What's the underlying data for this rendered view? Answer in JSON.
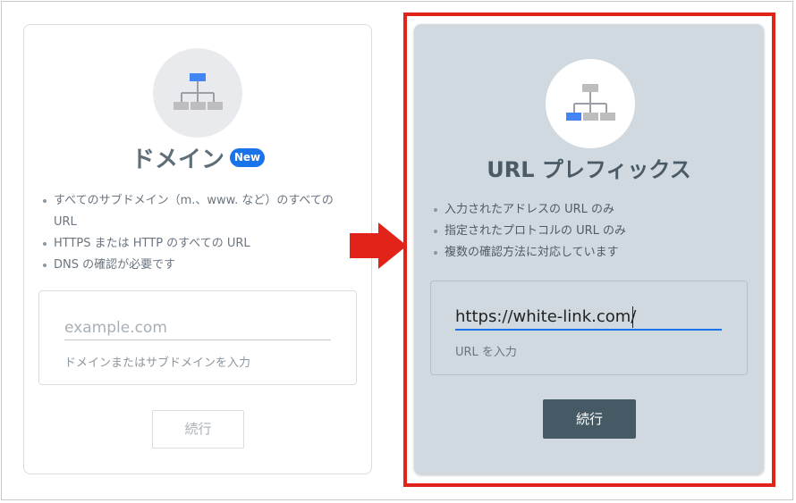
{
  "domain_card": {
    "title": "ドメイン",
    "badge": "New",
    "bullets": [
      "すべてのサブドメイン（m.、www. など）のすべての URL",
      "HTTPS または HTTP のすべての URL",
      "DNS の確認が必要です"
    ],
    "input_placeholder": "example.com",
    "input_helper": "ドメインまたはサブドメインを入力",
    "continue_label": "続行",
    "icon": "domain-sitemap-icon"
  },
  "url_prefix_card": {
    "title": "URL プレフィックス",
    "bullets": [
      "入力されたアドレスの URL のみ",
      "指定されたプロトコルの URL のみ",
      "複数の確認方法に対応しています"
    ],
    "input_value": "https://white-link.com/",
    "input_helper": "URL を入力",
    "continue_label": "続行",
    "icon": "url-prefix-sitemap-icon",
    "selected": true
  },
  "colors": {
    "highlight_border": "#e2231a",
    "arrow": "#e2231a",
    "accent_blue": "#1a73e8",
    "primary_button": "#455a64",
    "selected_card_bg": "#d0d9df"
  }
}
